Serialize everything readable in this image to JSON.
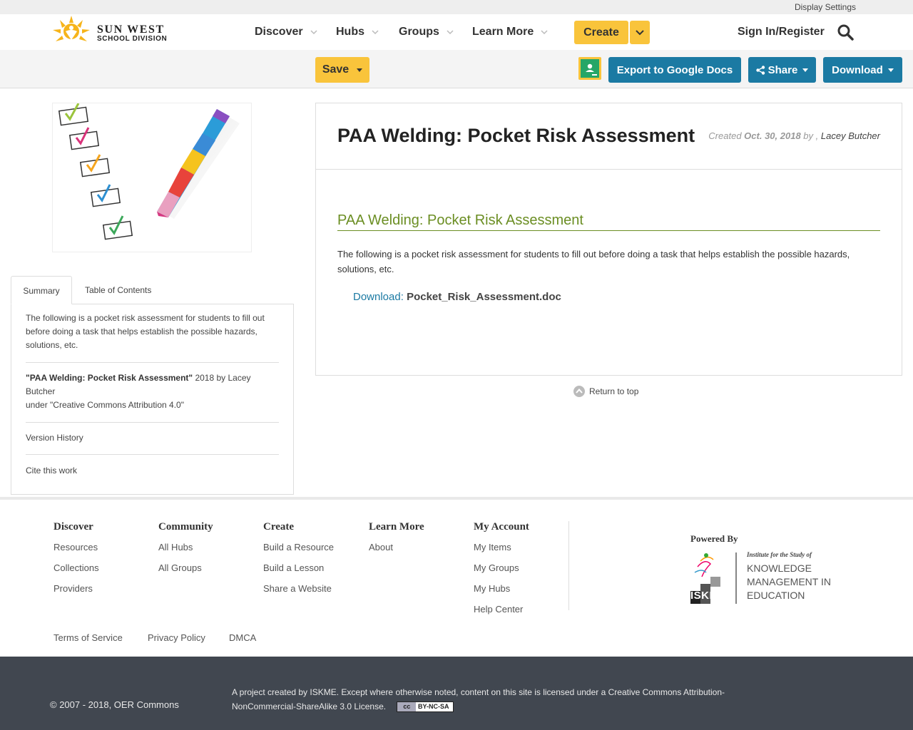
{
  "utility": {
    "display_settings": "Display Settings"
  },
  "logo": {
    "line1": "SUN WEST",
    "line2": "SCHOOL DIVISION"
  },
  "nav": {
    "items": [
      "Discover",
      "Hubs",
      "Groups",
      "Learn More"
    ],
    "create": "Create",
    "sign_in": "Sign In/Register"
  },
  "toolbar": {
    "save": "Save",
    "export": "Export to Google Docs",
    "share": "Share",
    "download": "Download"
  },
  "tabs": {
    "summary": "Summary",
    "toc": "Table of Contents"
  },
  "summary": {
    "description": "The following is a pocket risk assessment for students to fill out before doing a task that helps establish the possible hazards, solutions, etc.",
    "attribution_title": "\"PAA Welding: Pocket Risk Assessment\"",
    "attribution_by": " 2018 by Lacey Butcher",
    "attribution_license": "under \"Creative Commons Attribution 4.0\"",
    "version_history": "Version History",
    "cite": "Cite this work"
  },
  "resource": {
    "title": "PAA Welding: Pocket Risk Assessment",
    "created_label": "Created",
    "created_date": "Oct. 30, 2018",
    "by_label": "by ,",
    "author": "Lacey Butcher",
    "content_title": "PAA Welding: Pocket Risk Assessment",
    "content_description": "The following is a pocket risk assessment for students to fill out before doing a task that helps establish the possible hazards, solutions, etc.",
    "download_label": "Download:",
    "download_file": "Pocket_Risk_Assessment.doc",
    "return_top": "Return to top"
  },
  "footer": {
    "columns": [
      {
        "heading": "Discover",
        "links": [
          "Resources",
          "Collections",
          "Providers"
        ]
      },
      {
        "heading": "Community",
        "links": [
          "All Hubs",
          "All Groups"
        ]
      },
      {
        "heading": "Create",
        "links": [
          "Build a Resource",
          "Build a Lesson",
          "Share a Website"
        ]
      },
      {
        "heading": "Learn More",
        "links": [
          "About"
        ]
      },
      {
        "heading": "My Account",
        "links": [
          "My Items",
          "My Groups",
          "My Hubs",
          "Help Center"
        ]
      }
    ],
    "powered_by": "Powered By",
    "iskme_text": [
      "Institute for the Study of",
      "KNOWLEDGE",
      "MANAGEMENT IN",
      "EDUCATION"
    ],
    "iskme_logo": "ISKME",
    "legal": [
      "Terms of Service",
      "Privacy Policy",
      "DMCA"
    ],
    "copyright": "© 2007 - 2018, OER Commons",
    "project": "A project created by ISKME. Except where otherwise noted, content on this site is licensed under a Creative Commons Attribution-NonCommercial-ShareAlike 3.0 License.",
    "cc_badge": "BY-NC-SA",
    "cc_symbol": "cc"
  },
  "colors": {
    "accent_yellow": "#f9c43b",
    "button_blue": "#1b7aa3",
    "title_green": "#6b8e23",
    "footer_dark": "#414750"
  }
}
